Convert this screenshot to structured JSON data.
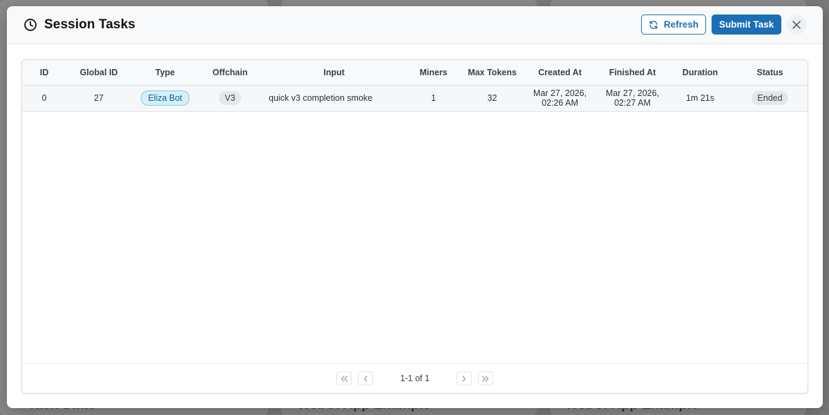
{
  "background": {
    "card_titles": [
      "Task Stats",
      "WebUI App Example",
      "WebUI App Example"
    ]
  },
  "modal": {
    "title": "Session Tasks",
    "refresh_label": "Refresh",
    "submit_label": "Submit Task"
  },
  "table": {
    "headers": {
      "id": "ID",
      "global_id": "Global ID",
      "type": "Type",
      "offchain": "Offchain",
      "input": "Input",
      "miners": "Miners",
      "max_tokens": "Max Tokens",
      "created_at": "Created At",
      "finished_at": "Finished At",
      "duration": "Duration",
      "status": "Status"
    },
    "rows": [
      {
        "id": "0",
        "global_id": "27",
        "type": "Eliza Bot",
        "offchain": "V3",
        "input": "quick v3 completion smoke",
        "miners": "1",
        "max_tokens": "32",
        "created_line1": "Mar 27, 2026,",
        "created_line2": "02:26 AM",
        "finished_line1": "Mar 27, 2026,",
        "finished_line2": "02:27 AM",
        "duration": "1m 21s",
        "status": "Ended"
      }
    ]
  },
  "pagination": {
    "label": "1-1 of 1"
  },
  "colors": {
    "primary": "#1a6fb5",
    "type_pill_bg": "#d5f0fa",
    "status_pill_bg": "#e4e6e8"
  }
}
